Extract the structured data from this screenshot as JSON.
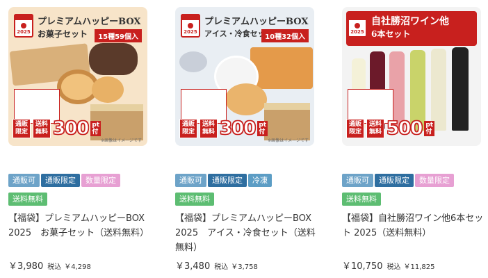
{
  "products": [
    {
      "banner_title": "プレミアムハッピーBOX",
      "banner_sub": "お菓子セット",
      "count_badge": "15種59個入",
      "year": "2025",
      "limited": "通販\n限定",
      "free_shipping": "送料\n無料",
      "points": "300",
      "points_unit": "pt\n付",
      "image_note": "※画像はイメージです",
      "bg_color": "#f7e4c9",
      "tags": [
        {
          "label": "通販可",
          "color": "blue"
        },
        {
          "label": "通販限定",
          "color": "navy"
        },
        {
          "label": "数量限定",
          "color": "pink"
        },
        {
          "label": "送料無料",
          "color": "green"
        }
      ],
      "title": "【福袋】プレミアムハッピーBOX 2025　お菓子セット（送料無料）",
      "price": "￥3,980",
      "tax_label": "税込",
      "tax_price": "￥4,298"
    },
    {
      "banner_title": "プレミアムハッピーBOX",
      "banner_sub": "アイス・冷食セット",
      "count_badge": "10種32個入",
      "year": "2025",
      "limited": "通販\n限定",
      "free_shipping": "送料\n無料",
      "points": "300",
      "points_unit": "pt\n付",
      "image_note": "※画像はイメージです",
      "bg_color": "#e9eef3",
      "tags": [
        {
          "label": "通販可",
          "color": "blue"
        },
        {
          "label": "通販限定",
          "color": "navy"
        },
        {
          "label": "冷凍",
          "color": "teal"
        },
        {
          "label": "送料無料",
          "color": "green"
        }
      ],
      "title": "【福袋】プレミアムハッピーBOX 2025　アイス・冷食セット（送料無料）",
      "price": "￥3,480",
      "tax_label": "税込",
      "tax_price": "￥3,758"
    },
    {
      "banner_title": "自社勝沼ワイン他",
      "banner_sub": "6本セット",
      "count_badge": "",
      "year": "2025",
      "limited": "通販\n限定",
      "free_shipping": "送料\n無料",
      "points": "500",
      "points_unit": "pt\n付",
      "image_note": "",
      "bg_color": "#f3f3f3",
      "tags": [
        {
          "label": "通販可",
          "color": "blue"
        },
        {
          "label": "通販限定",
          "color": "navy"
        },
        {
          "label": "数量限定",
          "color": "pink"
        },
        {
          "label": "送料無料",
          "color": "green"
        }
      ],
      "title": "【福袋】自社勝沼ワイン他6本セット 2025（送料無料）",
      "price": "￥10,750",
      "tax_label": "税込",
      "tax_price": "￥11,825"
    }
  ]
}
